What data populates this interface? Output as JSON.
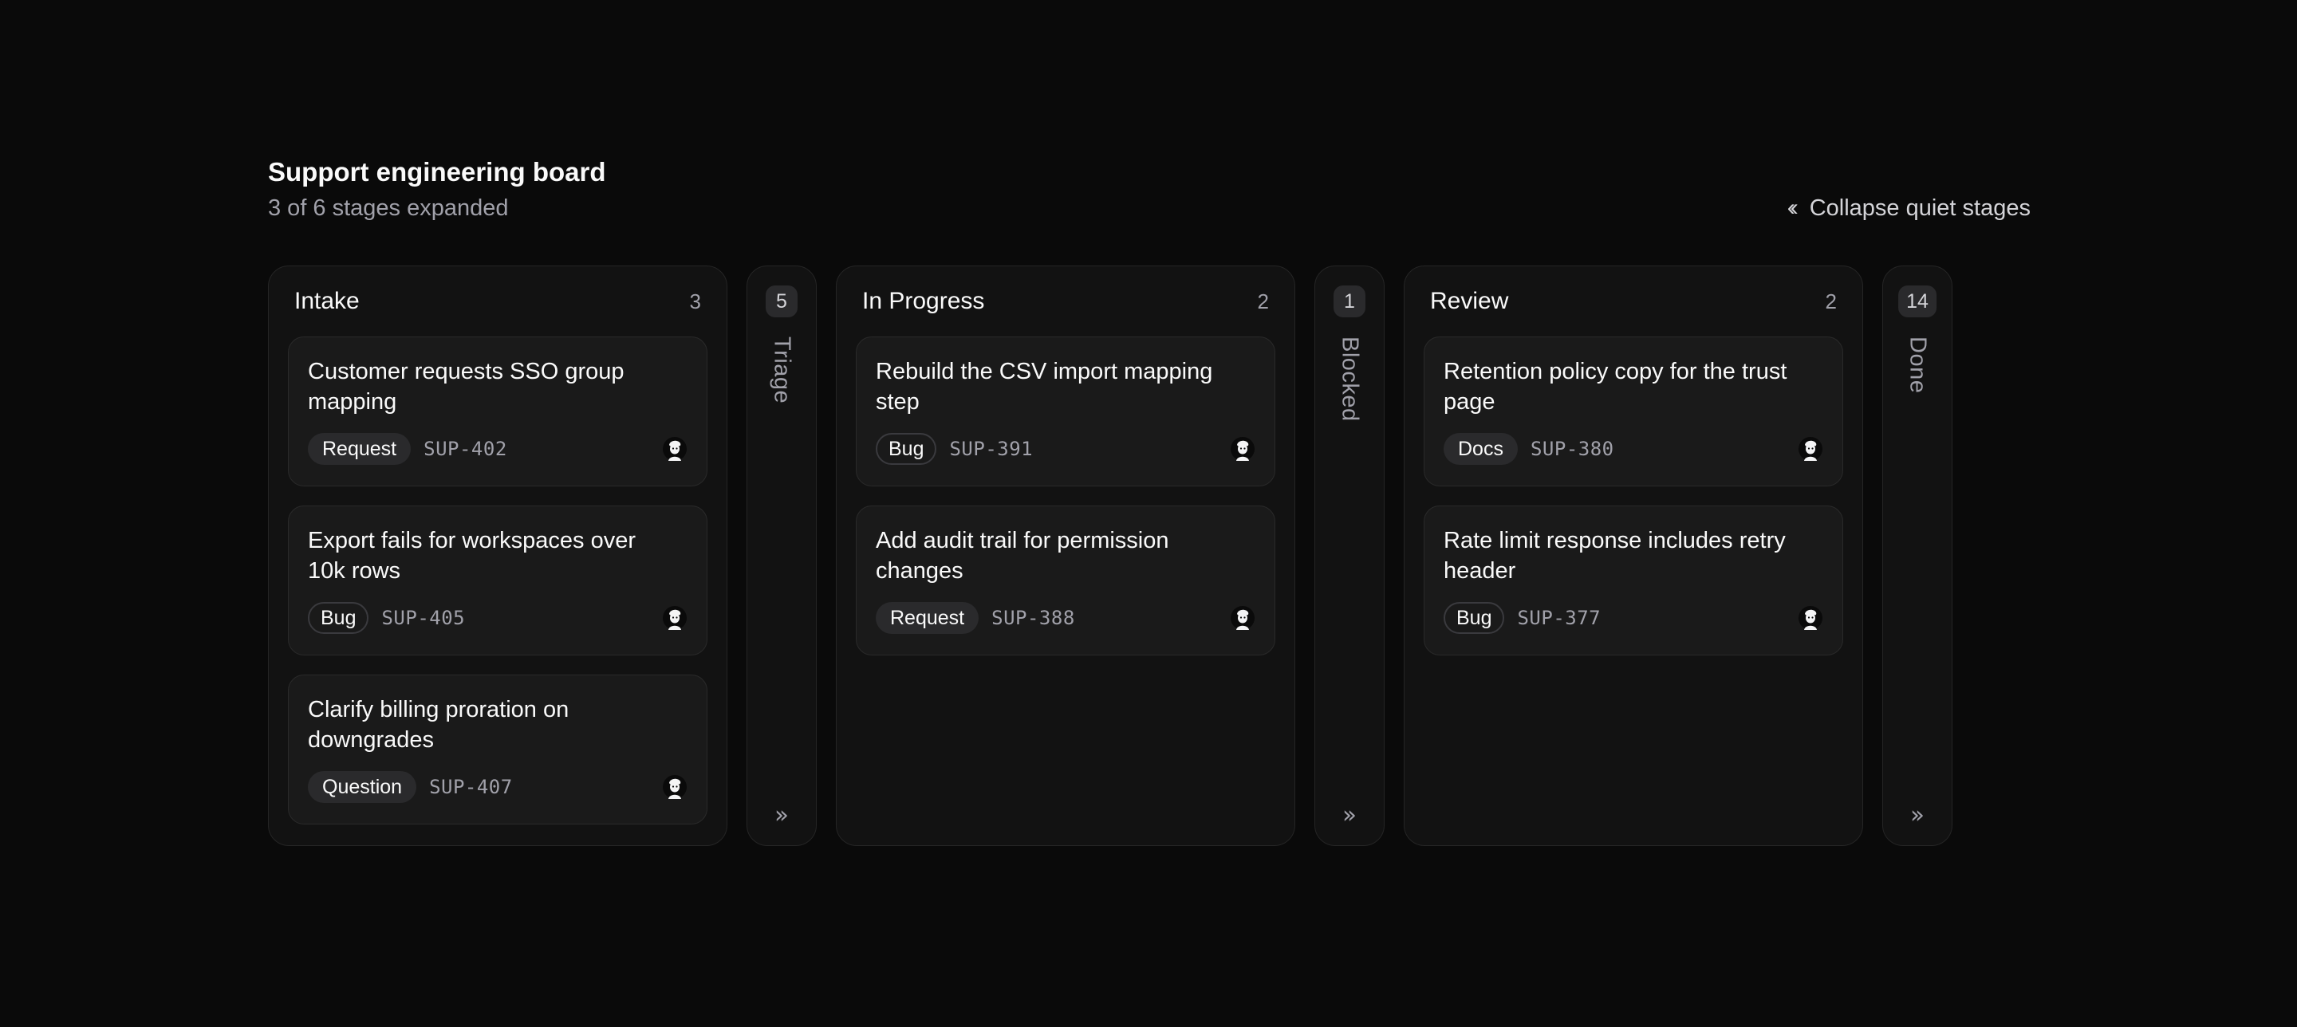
{
  "header": {
    "title": "Support engineering board",
    "subtitle": "3 of 6 stages expanded",
    "collapse_label": "Collapse quiet stages"
  },
  "columns": [
    {
      "title": "Intake",
      "count": "3",
      "expanded": true,
      "cards": [
        {
          "title": "Customer requests SSO group mapping",
          "tag": "Request",
          "tag_style": "filled",
          "id": "SUP-402"
        },
        {
          "title": "Export fails for workspaces over 10k rows",
          "tag": "Bug",
          "tag_style": "outline",
          "id": "SUP-405"
        },
        {
          "title": "Clarify billing proration on downgrades",
          "tag": "Question",
          "tag_style": "filled",
          "id": "SUP-407"
        }
      ]
    },
    {
      "title": "Triage",
      "count": "5",
      "expanded": false
    },
    {
      "title": "In Progress",
      "count": "2",
      "expanded": true,
      "cards": [
        {
          "title": "Rebuild the CSV import mapping step",
          "tag": "Bug",
          "tag_style": "outline",
          "id": "SUP-391"
        },
        {
          "title": "Add audit trail for permission changes",
          "tag": "Request",
          "tag_style": "filled",
          "id": "SUP-388"
        }
      ]
    },
    {
      "title": "Blocked",
      "count": "1",
      "expanded": false
    },
    {
      "title": "Review",
      "count": "2",
      "expanded": true,
      "cards": [
        {
          "title": "Retention policy copy for the trust page",
          "tag": "Docs",
          "tag_style": "filled",
          "id": "SUP-380"
        },
        {
          "title": "Rate limit response includes retry header",
          "tag": "Bug",
          "tag_style": "outline",
          "id": "SUP-377"
        }
      ]
    },
    {
      "title": "Done",
      "count": "14",
      "expanded": false
    }
  ],
  "icons": {
    "collapse": "chevrons-left-icon",
    "expand": "chevrons-right-icon",
    "avatar": "avatar-icon"
  },
  "colors": {
    "background": "#0a0a0a",
    "column": "#121212",
    "card": "#1a1a1a",
    "text": "#fafafa",
    "muted": "#a1a1aa"
  }
}
